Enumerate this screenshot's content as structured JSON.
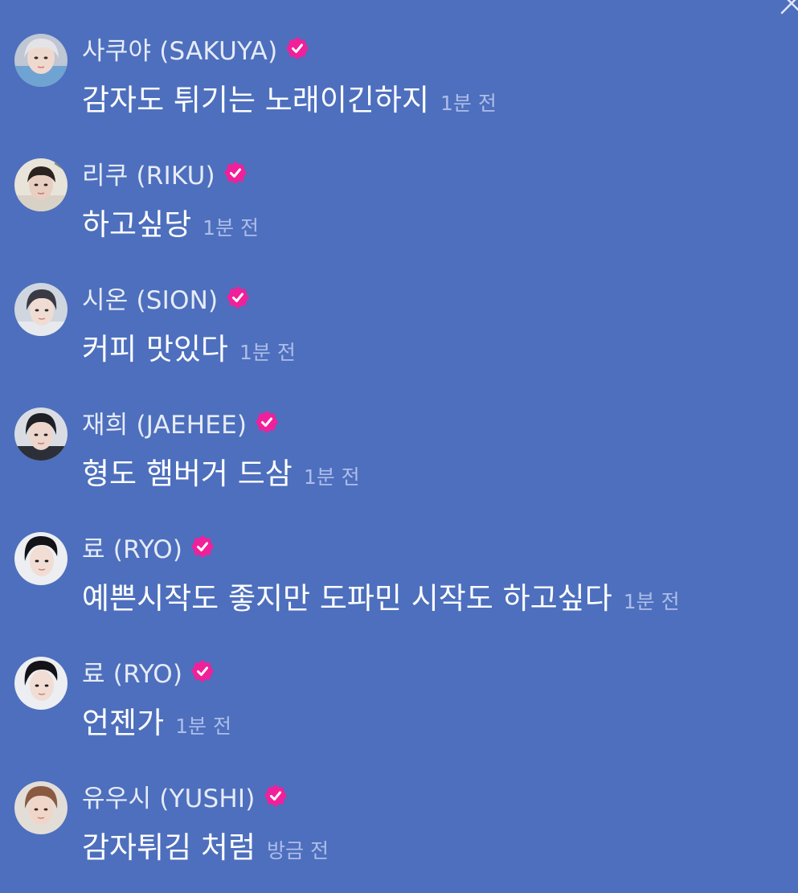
{
  "icons": {
    "verified_badge": "verified-badge-icon",
    "close": "close-icon"
  },
  "colors": {
    "background": "#4d6fbd",
    "verified_badge": "#f0209b",
    "name_text": "#e6ebf7",
    "message_text": "#ffffff",
    "time_text": "#aebdea"
  },
  "messages": [
    {
      "author": "사쿠야 (SAKUYA)",
      "text": "감자도 튀기는 노래이긴하지",
      "time": "1분 전"
    },
    {
      "author": "리쿠 (RIKU)",
      "text": "하고싶당",
      "time": "1분 전"
    },
    {
      "author": "시온 (SION)",
      "text": "커피 맛있다",
      "time": "1분 전"
    },
    {
      "author": "재희 (JAEHEE)",
      "text": "형도 햄버거 드삼",
      "time": "1분 전"
    },
    {
      "author": "료 (RYO)",
      "text": "예쁜시작도 좋지만 도파민 시작도 하고싶다",
      "time": "1분 전"
    },
    {
      "author": "료 (RYO)",
      "text": "언젠가",
      "time": "1분 전"
    },
    {
      "author": "유우시 (YUSHI)",
      "text": "감자튀김 처럼",
      "time": "방금 전"
    }
  ]
}
